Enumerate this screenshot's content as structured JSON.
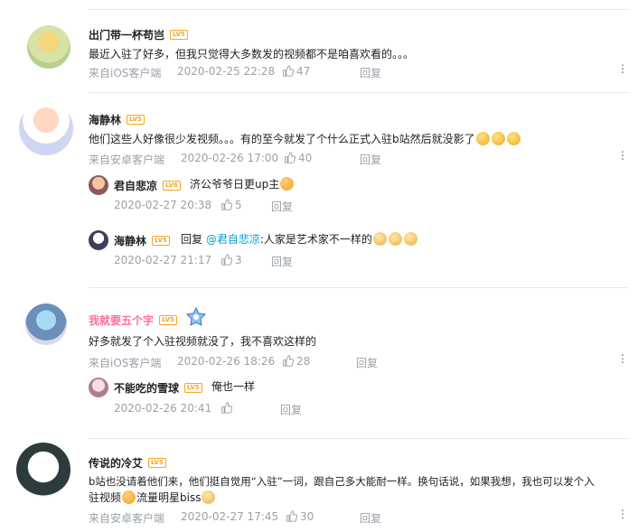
{
  "comments": [
    {
      "username": "出门带一杯苟岂",
      "level": "LV5",
      "text": "最近入驻了好多，但我只觉得大多数发的视频都不是咱喜欢看的。。。",
      "source": "来自iOS客户端",
      "time": "2020-02-25 22:28",
      "likes": "47",
      "reply_label": "回复"
    },
    {
      "username": "海静林",
      "level": "LV5",
      "text": "他们这些人好像很少发视频。。。有的至今就发了个什么正式入驻b站然后就没影了",
      "source": "来自安卓客户端",
      "time": "2020-02-26 17:00",
      "likes": "40",
      "reply_label": "回复",
      "replies": [
        {
          "username": "君自悲凉",
          "level": "LV6",
          "text": "济公爷爷日更up主",
          "time": "2020-02-27 20:38",
          "likes": "5",
          "reply_label": "回复"
        },
        {
          "username": "海静林",
          "level": "LV5",
          "prefix": "回复",
          "mention": "@君自悲凉",
          "text": ":人家是艺术家不一样的",
          "time": "2020-02-27 21:17",
          "likes": "3",
          "reply_label": "回复"
        }
      ]
    },
    {
      "username": "我就要五个字",
      "level": "LV5",
      "text": "好多就发了个入驻视频就没了，我不喜欢这样的",
      "source": "来自iOS客户端",
      "time": "2020-02-26 18:26",
      "likes": "28",
      "reply_label": "回复",
      "replies": [
        {
          "username": "不能吃的雪球",
          "level": "LV5",
          "text": "俺也一样",
          "time": "2020-02-26 20:41",
          "likes": "",
          "reply_label": "回复"
        }
      ]
    },
    {
      "username": "传说的冷艾",
      "level": "LV5",
      "text_line1": "b站也没请着他们来，他们挺自觉用“入驻”一词，跟自己多大能耐一样。换句话说，如果我想，我也可以发个入",
      "text_line2": "驻视频",
      "text_tail": "流量明星biss",
      "source": "来自安卓客户端",
      "time": "2020-02-27 17:45",
      "likes": "30",
      "reply_label": "回复"
    }
  ],
  "icons": {
    "like": "thumbs-up-icon",
    "more": "more-vertical-icon"
  },
  "colors": {
    "mention": "#00a1d6",
    "vip_name": "#fb7299",
    "level_badge": "#f5a623",
    "meta": "#99a2aa",
    "divider": "#e5e9ef"
  }
}
